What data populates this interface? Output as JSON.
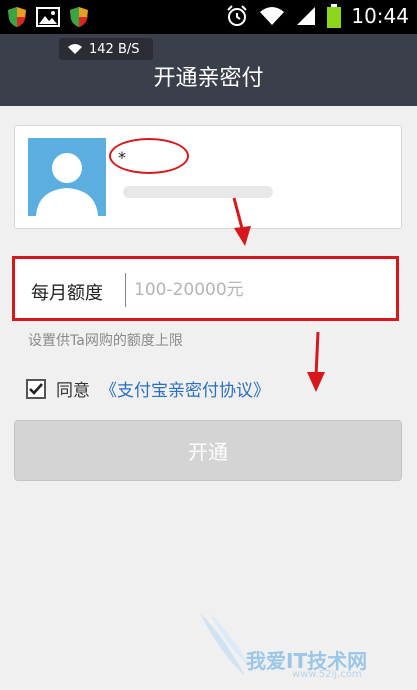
{
  "statusbar": {
    "time": "10:44",
    "icons": [
      "shield-icon",
      "image-icon",
      "shield-icon",
      "alarm-icon",
      "wifi-icon",
      "signal-icon",
      "battery-icon"
    ]
  },
  "header": {
    "network_speed": "142 B/S",
    "title": "开通亲密付"
  },
  "contact": {
    "name": "*",
    "avatar_color": "#5aaee0"
  },
  "quota": {
    "label": "每月额度",
    "placeholder": "100-20000元",
    "value": ""
  },
  "hint": "设置供Ta网购的额度上限",
  "agreement": {
    "checked": true,
    "text": "同意",
    "link": "《支付宝亲密付协议》"
  },
  "submit": {
    "label": "开通",
    "enabled": false
  },
  "colors": {
    "title_bar": "#3a3f4b",
    "highlight": "#d6171c",
    "link": "#2a6fc0"
  }
}
